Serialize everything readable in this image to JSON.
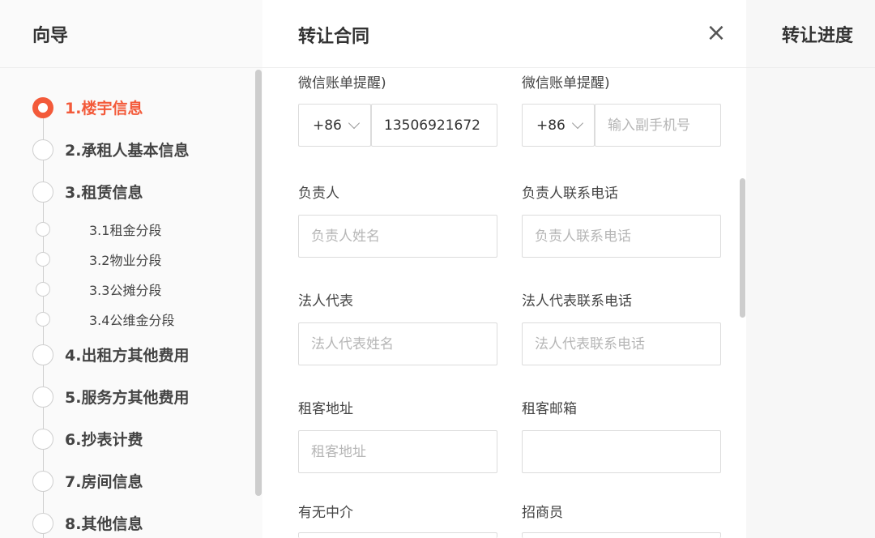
{
  "guide": {
    "title": "向导",
    "steps": [
      {
        "label": "1.楼宇信息"
      },
      {
        "label": "2.承租人基本信息"
      },
      {
        "label": "3.租赁信息"
      },
      {
        "label": "4.出租方其他费用"
      },
      {
        "label": "5.服务方其他费用"
      },
      {
        "label": "6.抄表计费"
      },
      {
        "label": "7.房间信息"
      },
      {
        "label": "8.其他信息"
      }
    ],
    "substeps": [
      {
        "label": "3.1租金分段"
      },
      {
        "label": "3.2物业分段"
      },
      {
        "label": "3.3公摊分段"
      },
      {
        "label": "3.4公维金分段"
      }
    ]
  },
  "modal": {
    "title": "转让合同",
    "close_glyph": "×",
    "wechat_label_left": "微信账单提醒)",
    "wechat_label_right": "微信账单提醒)",
    "phone_main": {
      "country_code": "+86",
      "value": "13506921672"
    },
    "phone_secondary": {
      "country_code": "+86",
      "placeholder": "输入副手机号"
    },
    "fields": {
      "manager_label": "负责人",
      "manager_placeholder": "负责人姓名",
      "manager_phone_label": "负责人联系电话",
      "manager_phone_placeholder": "负责人联系电话",
      "legal_rep_label": "法人代表",
      "legal_rep_placeholder": "法人代表姓名",
      "legal_rep_phone_label": "法人代表联系电话",
      "legal_rep_phone_placeholder": "法人代表联系电话",
      "address_label": "租客地址",
      "address_placeholder": "租客地址",
      "email_label": "租客邮箱",
      "email_placeholder": "",
      "agent_label": "有无中介",
      "recruiter_label": "招商员"
    }
  },
  "progress": {
    "title": "转让进度"
  },
  "colors": {
    "accent": "#f35a3a",
    "border": "#dcdcdc",
    "placeholder": "#b6b6b6"
  }
}
